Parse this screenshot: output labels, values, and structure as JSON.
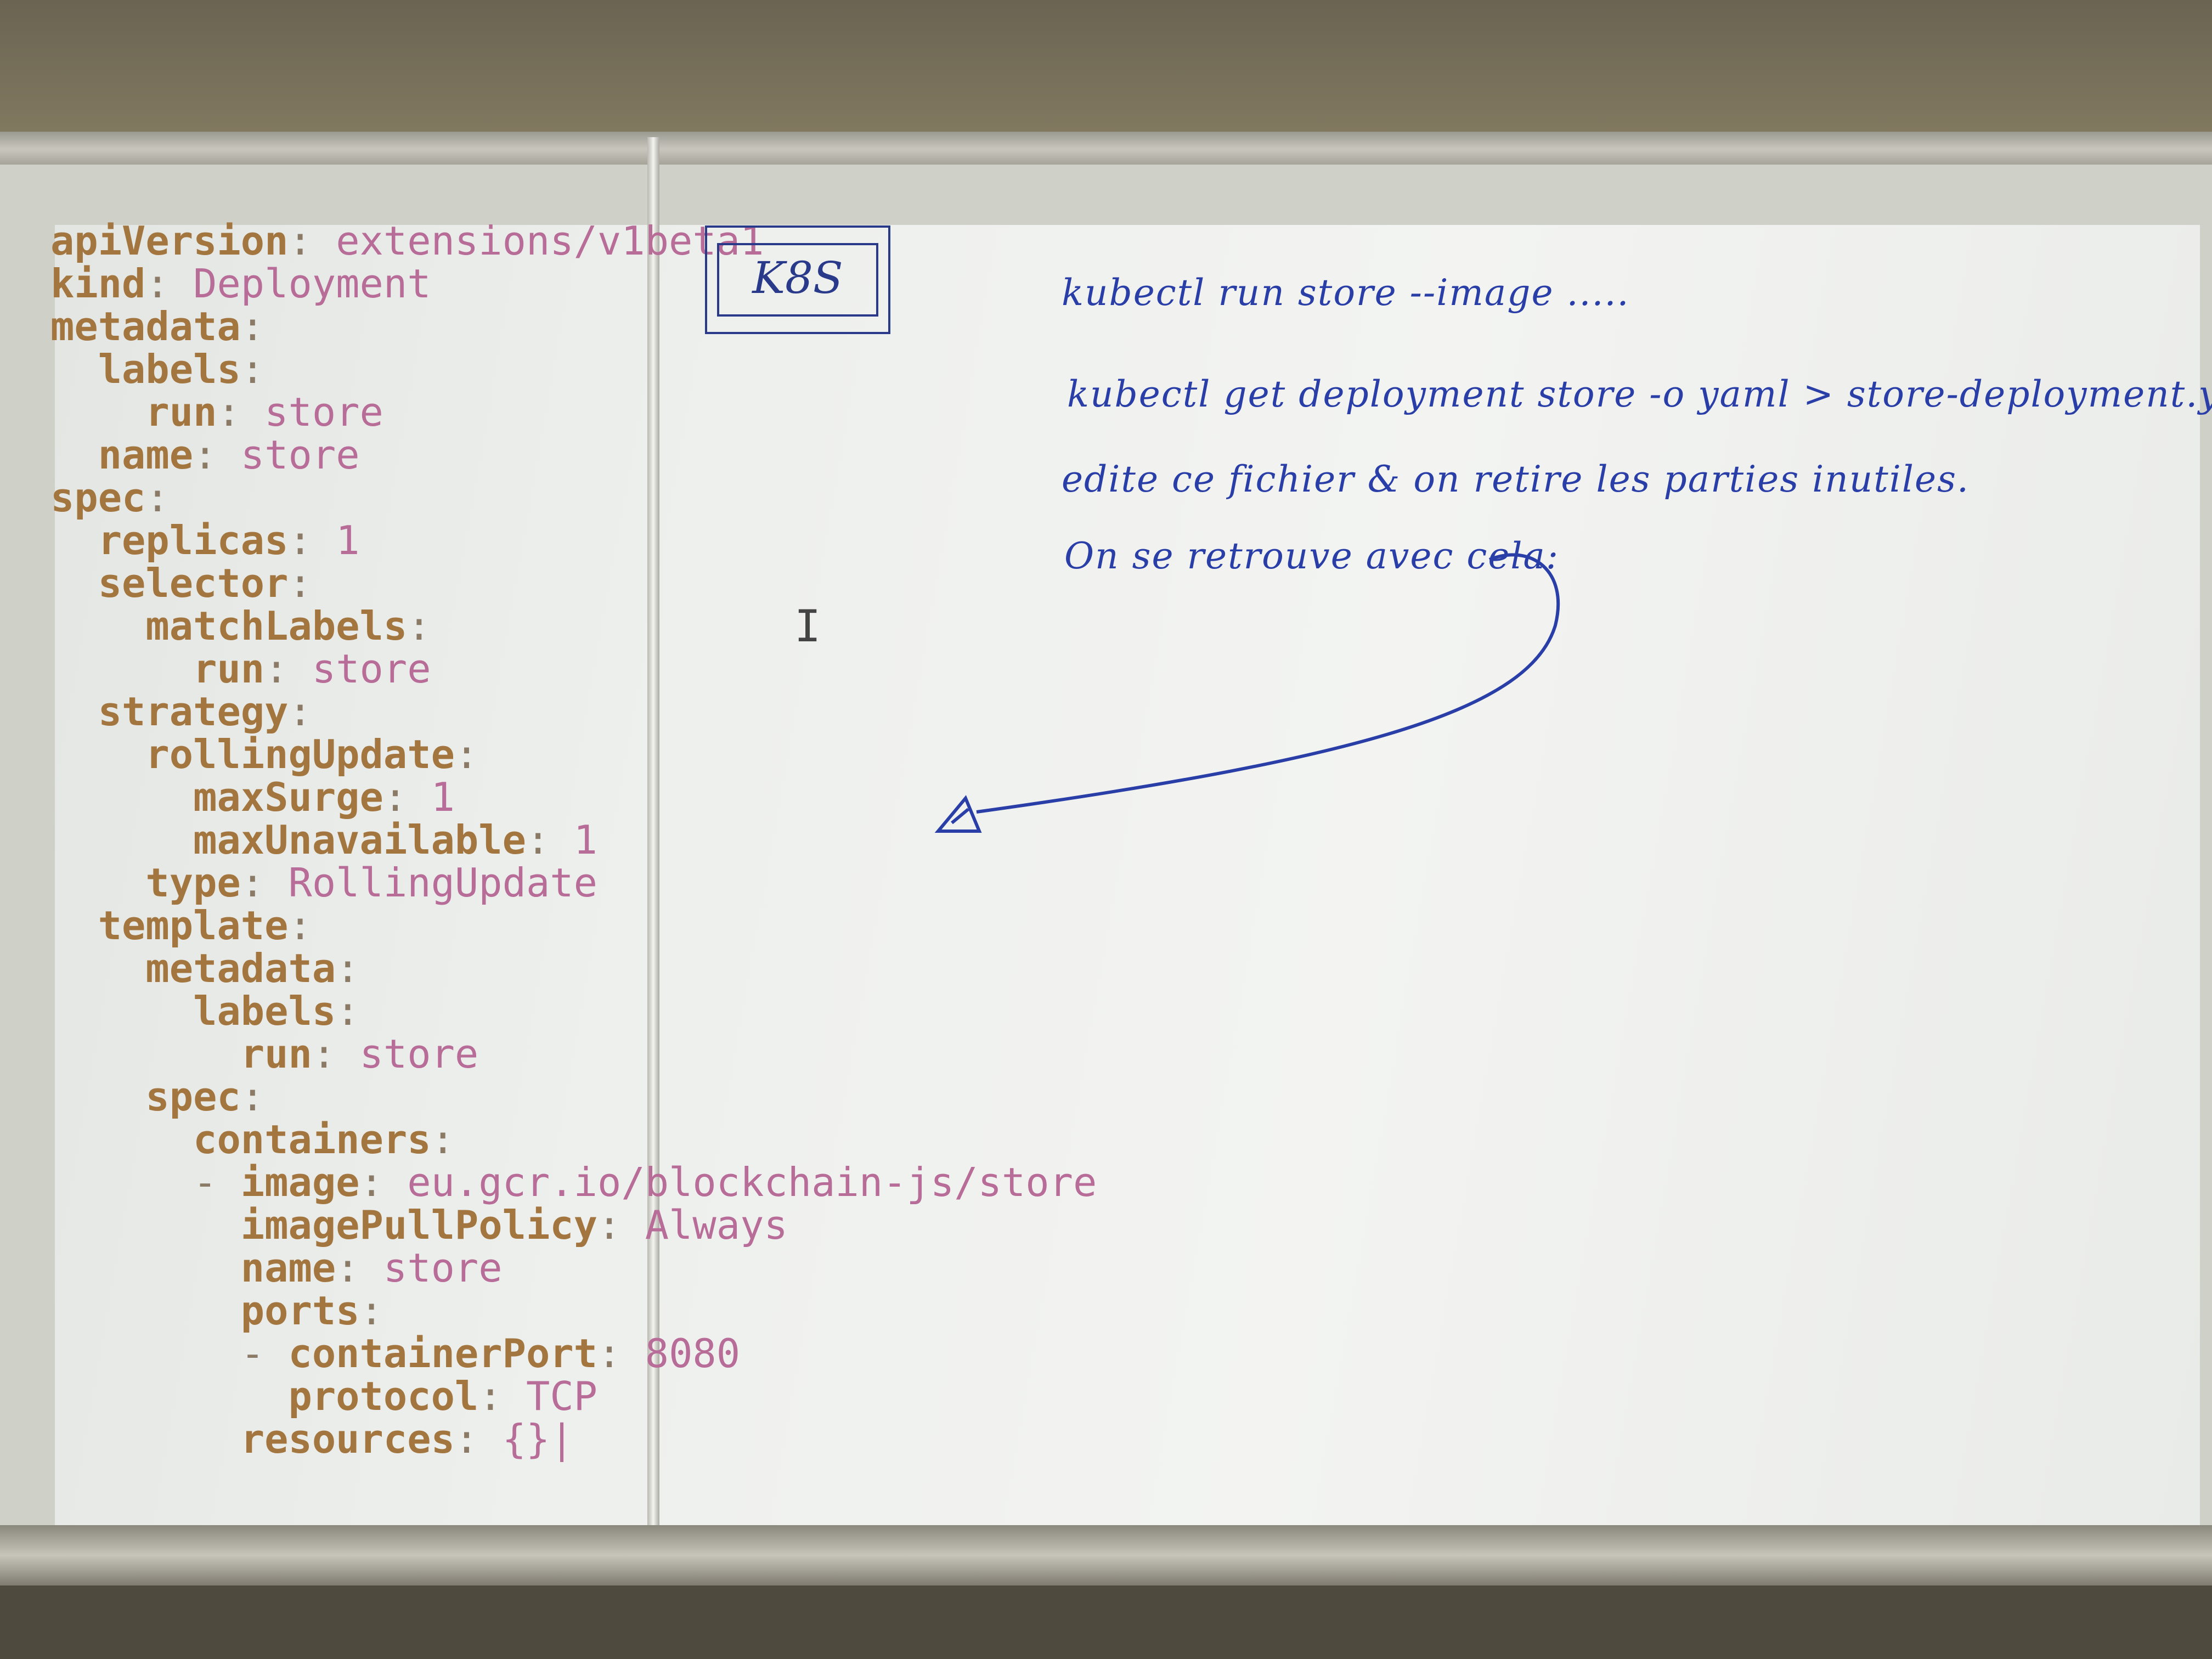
{
  "yaml_lines": [
    {
      "indent": "",
      "key": "apiVersion",
      "value": "extensions/v1beta1"
    },
    {
      "indent": "",
      "key": "kind",
      "value": "Deployment"
    },
    {
      "indent": "",
      "key": "metadata",
      "value": ""
    },
    {
      "indent": "  ",
      "key": "labels",
      "value": ""
    },
    {
      "indent": "    ",
      "key": "run",
      "value": "store"
    },
    {
      "indent": "  ",
      "key": "name",
      "value": "store"
    },
    {
      "indent": "",
      "key": "spec",
      "value": ""
    },
    {
      "indent": "  ",
      "key": "replicas",
      "value": "1"
    },
    {
      "indent": "  ",
      "key": "selector",
      "value": ""
    },
    {
      "indent": "    ",
      "key": "matchLabels",
      "value": ""
    },
    {
      "indent": "      ",
      "key": "run",
      "value": "store"
    },
    {
      "indent": "  ",
      "key": "strategy",
      "value": ""
    },
    {
      "indent": "    ",
      "key": "rollingUpdate",
      "value": ""
    },
    {
      "indent": "      ",
      "key": "maxSurge",
      "value": "1"
    },
    {
      "indent": "      ",
      "key": "maxUnavailable",
      "value": "1"
    },
    {
      "indent": "    ",
      "key": "type",
      "value": "RollingUpdate"
    },
    {
      "indent": "  ",
      "key": "template",
      "value": ""
    },
    {
      "indent": "    ",
      "key": "metadata",
      "value": ""
    },
    {
      "indent": "      ",
      "key": "labels",
      "value": ""
    },
    {
      "indent": "        ",
      "key": "run",
      "value": "store"
    },
    {
      "indent": "    ",
      "key": "spec",
      "value": ""
    },
    {
      "indent": "      ",
      "key": "containers",
      "value": ""
    },
    {
      "indent": "      - ",
      "key": "image",
      "value": "eu.gcr.io/blockchain-js/store"
    },
    {
      "indent": "        ",
      "key": "imagePullPolicy",
      "value": "Always"
    },
    {
      "indent": "        ",
      "key": "name",
      "value": "store"
    },
    {
      "indent": "        ",
      "key": "ports",
      "value": ""
    },
    {
      "indent": "        - ",
      "key": "containerPort",
      "value": "8080"
    },
    {
      "indent": "          ",
      "key": "protocol",
      "value": "TCP"
    },
    {
      "indent": "        ",
      "key": "resources",
      "value": "{}|"
    }
  ],
  "logo_box": "K8S",
  "handwriting": [
    "kubectl run store --image .....",
    "kubectl get deployment store -o yaml > store-deployment.yaml",
    "edite ce fichier & on retire les parties inutiles.",
    "On se retrouve avec cela:"
  ],
  "colors": {
    "ink": "#2a3ea8",
    "key": "#a4763f",
    "value": "#b86c98"
  }
}
